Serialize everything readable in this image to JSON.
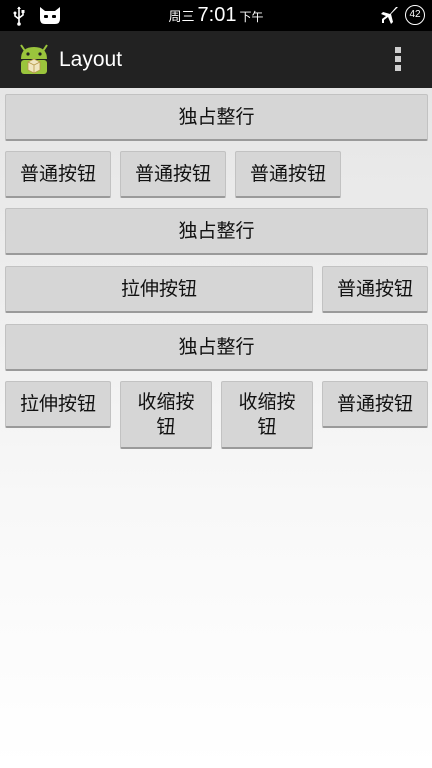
{
  "status_bar": {
    "weekday": "周三",
    "time": "7:01",
    "ampm": "下午",
    "battery": "42",
    "icons": [
      "usb-icon",
      "cyanogen-cat-icon",
      "airplane-mode-icon",
      "battery-icon"
    ]
  },
  "action_bar": {
    "title": "Layout",
    "icons": [
      "android-app-icon",
      "overflow-menu-icon"
    ]
  },
  "rows": [
    {
      "buttons": [
        {
          "label": "独占整行"
        }
      ]
    },
    {
      "buttons": [
        {
          "label": "普通按钮"
        },
        {
          "label": "普通按钮"
        },
        {
          "label": "普通按钮"
        }
      ]
    },
    {
      "buttons": [
        {
          "label": "独占整行"
        }
      ]
    },
    {
      "buttons": [
        {
          "label": "拉伸按钮"
        },
        {
          "label": "普通按钮"
        }
      ]
    },
    {
      "buttons": [
        {
          "label": "独占整行"
        }
      ]
    },
    {
      "buttons": [
        {
          "label": "拉伸按钮"
        },
        {
          "label": "收缩按钮"
        },
        {
          "label": "收缩按钮"
        },
        {
          "label": "普通按钮"
        }
      ]
    }
  ],
  "colors": {
    "status_bar": "#000000",
    "action_bar": "#222222",
    "button_face": "#d6d6d6",
    "android_green": "#9ac43c"
  }
}
